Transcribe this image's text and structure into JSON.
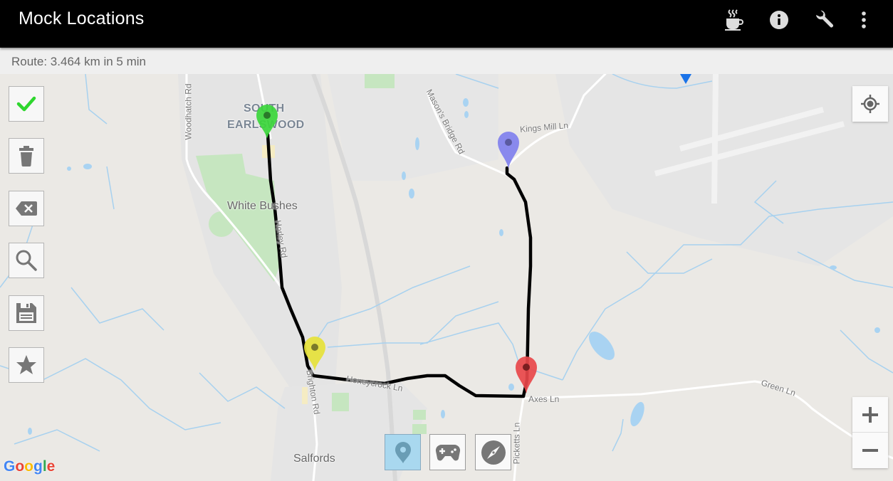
{
  "app": {
    "title": "Mock Locations",
    "actions": [
      {
        "name": "coffee-icon",
        "label": "Donate"
      },
      {
        "name": "info-icon",
        "label": "Info"
      },
      {
        "name": "wrench-icon",
        "label": "Settings"
      },
      {
        "name": "more-vert-icon",
        "label": "More options"
      }
    ]
  },
  "status": {
    "route_text": "Route: 3.464 km in 5 min",
    "distance_km": 3.464,
    "duration_min": 5
  },
  "toolbar": {
    "items": [
      {
        "name": "confirm-button",
        "icon": "check-icon",
        "label": "Confirm",
        "color": "#2ed62e"
      },
      {
        "name": "delete-button",
        "icon": "trash-icon",
        "label": "Delete"
      },
      {
        "name": "backspace-button",
        "icon": "backspace-icon",
        "label": "Remove last point"
      },
      {
        "name": "search-button",
        "icon": "search-icon",
        "label": "Search"
      },
      {
        "name": "save-button",
        "icon": "save-icon",
        "label": "Save"
      },
      {
        "name": "favorite-button",
        "icon": "star-icon",
        "label": "Favorites"
      }
    ]
  },
  "modes": {
    "items": [
      {
        "name": "mode-location",
        "icon": "map-pin-icon",
        "label": "Location",
        "active": true
      },
      {
        "name": "mode-joystick",
        "icon": "gamepad-icon",
        "label": "Joystick",
        "active": false
      },
      {
        "name": "mode-route",
        "icon": "compass-icon",
        "label": "Route",
        "active": false
      }
    ]
  },
  "map_controls": {
    "my_location": "my-location",
    "zoom_in": "+",
    "zoom_out": "−"
  },
  "map": {
    "attribution": "Google",
    "labels": {
      "south_earlswood_1": "SOUTH",
      "south_earlswood_2": "EARLSWOOD",
      "white_bushes": "White Bushes",
      "woodhatch_rd": "Woodhatch Rd",
      "horley_rd": "Horley Rd",
      "masons_bridge_rd": "Mason's Bridge Rd",
      "kings_mill_ln": "Kings Mill Ln",
      "honeycrock_ln": "Honeycrock Ln",
      "brighton_rd": "Brighton Rd",
      "axes_ln": "Axes Ln",
      "picketts_ln": "Picketts Ln",
      "green_ln": "Green Ln",
      "salfords": "Salfords"
    },
    "markers": [
      {
        "name": "start-marker",
        "color": "#3bd63b"
      },
      {
        "name": "waypoint-marker",
        "color": "#e6e23a"
      },
      {
        "name": "waypoint-marker-2",
        "color": "#e8474a"
      },
      {
        "name": "end-marker",
        "color": "#8080ee"
      }
    ],
    "route_color": "#000000"
  }
}
